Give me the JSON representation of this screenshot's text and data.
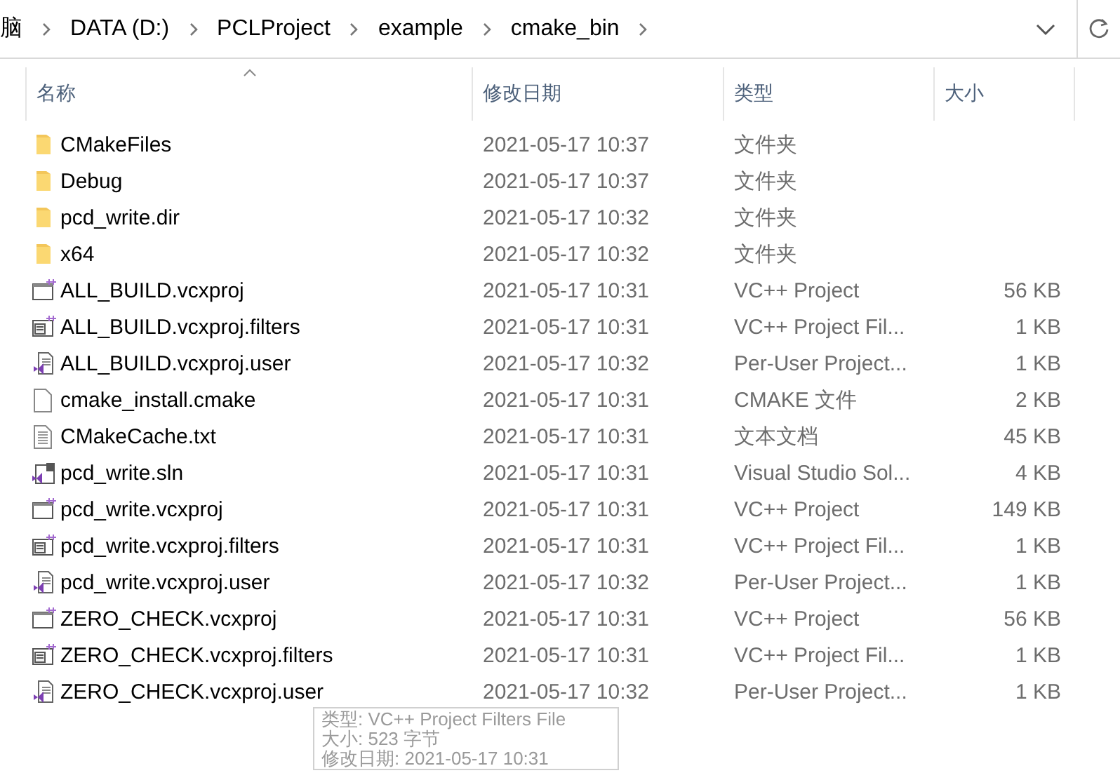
{
  "address_bar": {
    "crumbs": [
      "脑",
      "DATA (D:)",
      "PCLProject",
      "example",
      "cmake_bin"
    ]
  },
  "columns": [
    {
      "label": "名称",
      "sorted": true
    },
    {
      "label": "修改日期",
      "sorted": false
    },
    {
      "label": "类型",
      "sorted": false
    },
    {
      "label": "大小",
      "sorted": false
    }
  ],
  "rows": [
    {
      "kind": "folder",
      "name": "CMakeFiles",
      "date": "2021-05-17 10:37",
      "type": "文件夹",
      "size": ""
    },
    {
      "kind": "folder",
      "name": "Debug",
      "date": "2021-05-17 10:37",
      "type": "文件夹",
      "size": ""
    },
    {
      "kind": "folder",
      "name": "pcd_write.dir",
      "date": "2021-05-17 10:32",
      "type": "文件夹",
      "size": ""
    },
    {
      "kind": "folder",
      "name": "x64",
      "date": "2021-05-17 10:32",
      "type": "文件夹",
      "size": ""
    },
    {
      "kind": "project",
      "name": "ALL_BUILD.vcxproj",
      "date": "2021-05-17 10:31",
      "type": "VC++ Project",
      "size": "56 KB"
    },
    {
      "kind": "filters",
      "name": "ALL_BUILD.vcxproj.filters",
      "date": "2021-05-17 10:31",
      "type": "VC++ Project Fil...",
      "size": "1 KB"
    },
    {
      "kind": "user",
      "name": "ALL_BUILD.vcxproj.user",
      "date": "2021-05-17 10:32",
      "type": "Per-User Project...",
      "size": "1 KB"
    },
    {
      "kind": "blank",
      "name": "cmake_install.cmake",
      "date": "2021-05-17 10:31",
      "type": "CMAKE 文件",
      "size": "2 KB"
    },
    {
      "kind": "text",
      "name": "CMakeCache.txt",
      "date": "2021-05-17 10:31",
      "type": "文本文档",
      "size": "45 KB"
    },
    {
      "kind": "solution",
      "name": "pcd_write.sln",
      "date": "2021-05-17 10:31",
      "type": "Visual Studio Sol...",
      "size": "4 KB"
    },
    {
      "kind": "project",
      "name": "pcd_write.vcxproj",
      "date": "2021-05-17 10:31",
      "type": "VC++ Project",
      "size": "149 KB"
    },
    {
      "kind": "filters",
      "name": "pcd_write.vcxproj.filters",
      "date": "2021-05-17 10:31",
      "type": "VC++ Project Fil...",
      "size": "1 KB"
    },
    {
      "kind": "user",
      "name": "pcd_write.vcxproj.user",
      "date": "2021-05-17 10:32",
      "type": "Per-User Project...",
      "size": "1 KB"
    },
    {
      "kind": "project",
      "name": "ZERO_CHECK.vcxproj",
      "date": "2021-05-17 10:31",
      "type": "VC++ Project",
      "size": "56 KB"
    },
    {
      "kind": "filters",
      "name": "ZERO_CHECK.vcxproj.filters",
      "date": "2021-05-17 10:31",
      "type": "VC++ Project Fil...",
      "size": "1 KB"
    },
    {
      "kind": "user",
      "name": "ZERO_CHECK.vcxproj.user",
      "date": "2021-05-17 10:32",
      "type": "Per-User Project...",
      "size": "1 KB"
    }
  ],
  "tooltip": {
    "lines": [
      "类型: VC++ Project Filters File",
      "大小: 523 字节",
      "修改日期: 2021-05-17 10:31"
    ]
  }
}
